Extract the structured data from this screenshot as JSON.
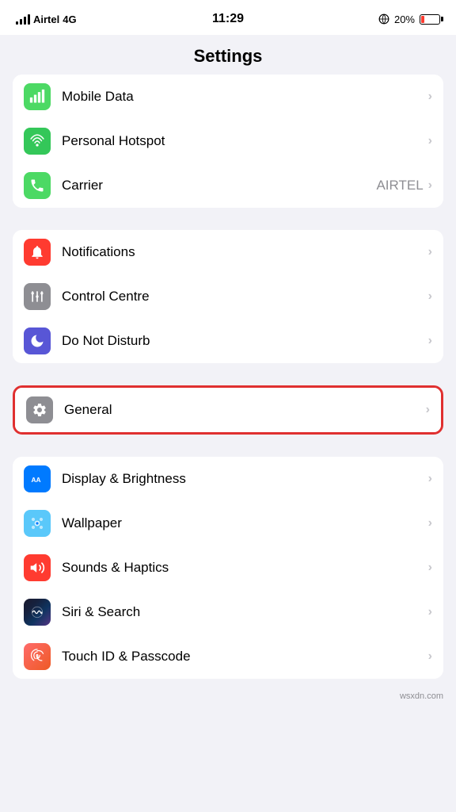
{
  "statusBar": {
    "carrier": "Airtel",
    "network": "4G",
    "time": "11:29",
    "batteryPercent": "20%"
  },
  "header": {
    "title": "Settings"
  },
  "sections": [
    {
      "id": "connectivity",
      "rows": [
        {
          "id": "mobile-data",
          "label": "Mobile Data",
          "icon": "wifi-cellular",
          "iconBg": "icon-green",
          "value": "",
          "chevron": true
        },
        {
          "id": "personal-hotspot",
          "label": "Personal Hotspot",
          "icon": "hotspot",
          "iconBg": "icon-green2",
          "value": "",
          "chevron": true
        },
        {
          "id": "carrier",
          "label": "Carrier",
          "icon": "phone",
          "iconBg": "icon-phone-green",
          "value": "AIRTEL",
          "chevron": true
        }
      ]
    },
    {
      "id": "system1",
      "rows": [
        {
          "id": "notifications",
          "label": "Notifications",
          "icon": "bell",
          "iconBg": "icon-red",
          "value": "",
          "chevron": true
        },
        {
          "id": "control-centre",
          "label": "Control Centre",
          "icon": "sliders",
          "iconBg": "icon-gray",
          "value": "",
          "chevron": true
        },
        {
          "id": "do-not-disturb",
          "label": "Do Not Disturb",
          "icon": "moon",
          "iconBg": "icon-indigo",
          "value": "",
          "chevron": true
        }
      ]
    },
    {
      "id": "system2-general",
      "highlighted": true,
      "rows": [
        {
          "id": "general",
          "label": "General",
          "icon": "gear",
          "iconBg": "icon-gray",
          "value": "",
          "chevron": true
        }
      ]
    },
    {
      "id": "system2",
      "rows": [
        {
          "id": "display-brightness",
          "label": "Display & Brightness",
          "icon": "display",
          "iconBg": "icon-blue",
          "value": "",
          "chevron": true
        },
        {
          "id": "wallpaper",
          "label": "Wallpaper",
          "icon": "wallpaper",
          "iconBg": "icon-teal",
          "value": "",
          "chevron": true
        },
        {
          "id": "sounds-haptics",
          "label": "Sounds & Haptics",
          "icon": "speaker",
          "iconBg": "icon-red",
          "value": "",
          "chevron": true
        },
        {
          "id": "siri-search",
          "label": "Siri & Search",
          "icon": "siri",
          "iconBg": "icon-siri",
          "value": "",
          "chevron": true
        },
        {
          "id": "touch-id",
          "label": "Touch ID & Passcode",
          "icon": "fingerprint",
          "iconBg": "icon-touch-id",
          "value": "",
          "chevron": true
        }
      ]
    }
  ],
  "watermark": "wsxdn.com"
}
